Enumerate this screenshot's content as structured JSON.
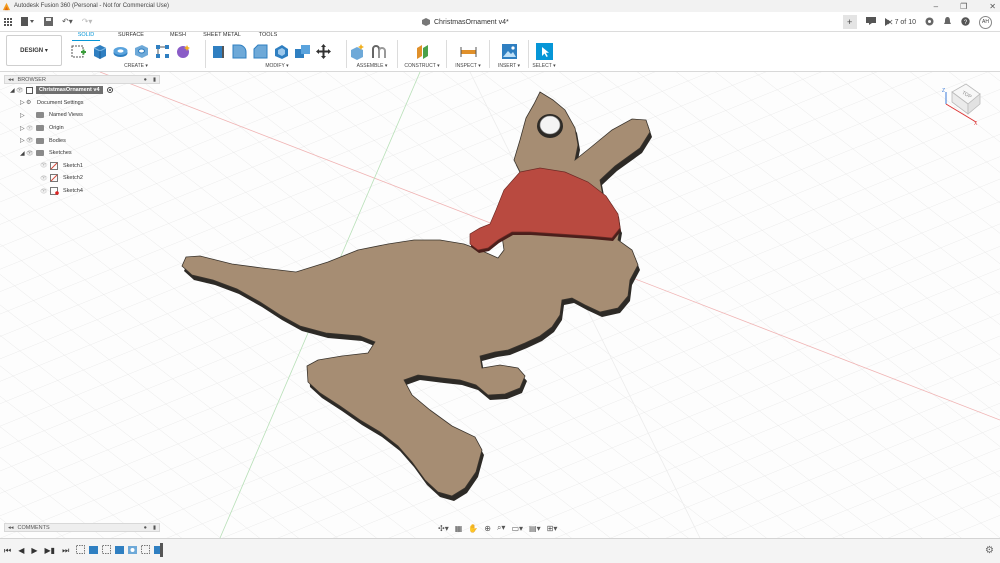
{
  "window": {
    "title": "Autodesk Fusion 360 (Personal - Not for Commercial Use)"
  },
  "document": {
    "tab_title": "ChristmasOrnament v4*",
    "job_status": "7 of 10"
  },
  "user": {
    "initials": "AH"
  },
  "workspace": {
    "label": "DESIGN"
  },
  "ribbon": {
    "tabs": [
      {
        "label": "SOLID",
        "active": true
      },
      {
        "label": "SURFACE",
        "active": false
      },
      {
        "label": "MESH",
        "active": false
      },
      {
        "label": "SHEET METAL",
        "active": false
      },
      {
        "label": "TOOLS",
        "active": false
      }
    ],
    "groups": {
      "create": "CREATE ▾",
      "modify": "MODIFY ▾",
      "assemble": "ASSEMBLE ▾",
      "construct": "CONSTRUCT ▾",
      "inspect": "INSPECT ▾",
      "insert": "INSERT ▾",
      "select": "SELECT ▾"
    }
  },
  "browser": {
    "header": "BROWSER",
    "root": "ChristmasOrnament v4",
    "items": [
      {
        "label": "Document Settings"
      },
      {
        "label": "Named Views"
      },
      {
        "label": "Origin"
      },
      {
        "label": "Bodies"
      },
      {
        "label": "Sketches"
      }
    ],
    "sketches": [
      {
        "label": "Sketch1"
      },
      {
        "label": "Sketch2"
      },
      {
        "label": "Sketch4"
      }
    ]
  },
  "comments": {
    "header": "COMMENTS"
  },
  "viewcube": {
    "face": "TOP"
  },
  "colors": {
    "body": "#a68d73",
    "body_edge": "#2d2a26",
    "hat": "#b94a40",
    "accent": "#0696d7"
  }
}
